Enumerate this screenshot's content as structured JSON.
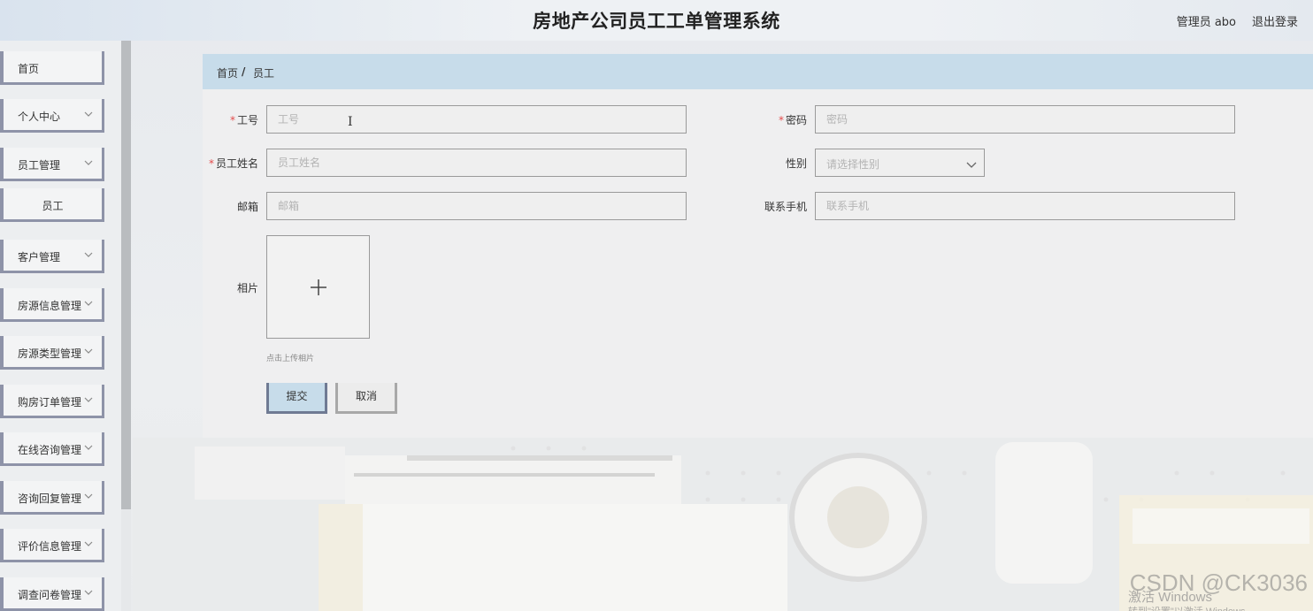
{
  "header": {
    "title": "房地产公司员工工单管理系统",
    "user": "管理员 abo",
    "logout": "退出登录"
  },
  "sidebar": {
    "items": [
      {
        "label": "首页",
        "expandable": false
      },
      {
        "label": "个人中心",
        "expandable": true
      },
      {
        "label": "员工管理",
        "expandable": true,
        "expanded": true
      },
      {
        "label": "员工",
        "sub": true
      },
      {
        "label": "客户管理",
        "expandable": true
      },
      {
        "label": "房源信息管理",
        "expandable": true
      },
      {
        "label": "房源类型管理",
        "expandable": true
      },
      {
        "label": "购房订单管理",
        "expandable": true
      },
      {
        "label": "在线咨询管理",
        "expandable": true
      },
      {
        "label": "咨询回复管理",
        "expandable": true
      },
      {
        "label": "评价信息管理",
        "expandable": true
      },
      {
        "label": "调查问卷管理",
        "expandable": true
      }
    ]
  },
  "breadcrumb": {
    "home": "首页",
    "separator": "/",
    "current": "员工"
  },
  "form": {
    "employee_no": {
      "label": "工号",
      "required": true,
      "placeholder": "工号",
      "value": ""
    },
    "password": {
      "label": "密码",
      "required": true,
      "placeholder": "密码",
      "value": ""
    },
    "name": {
      "label": "员工姓名",
      "required": true,
      "placeholder": "员工姓名",
      "value": ""
    },
    "gender": {
      "label": "性别",
      "placeholder": "请选择性别"
    },
    "email": {
      "label": "邮箱",
      "placeholder": "邮箱",
      "value": ""
    },
    "phone": {
      "label": "联系手机",
      "placeholder": "联系手机",
      "value": ""
    },
    "photo": {
      "label": "相片",
      "tip": "点击上传相片"
    },
    "submit_label": "提交",
    "cancel_label": "取消"
  },
  "overlay": {
    "watermark": "CSDN @CK3036",
    "activate_windows": "激活 Windows",
    "activate_hint": "转到\"设置\"以激活 Windows。"
  },
  "colors": {
    "accent": "#c7dcea",
    "menu_border": "#8e93a8",
    "required": "#e34b4b"
  }
}
